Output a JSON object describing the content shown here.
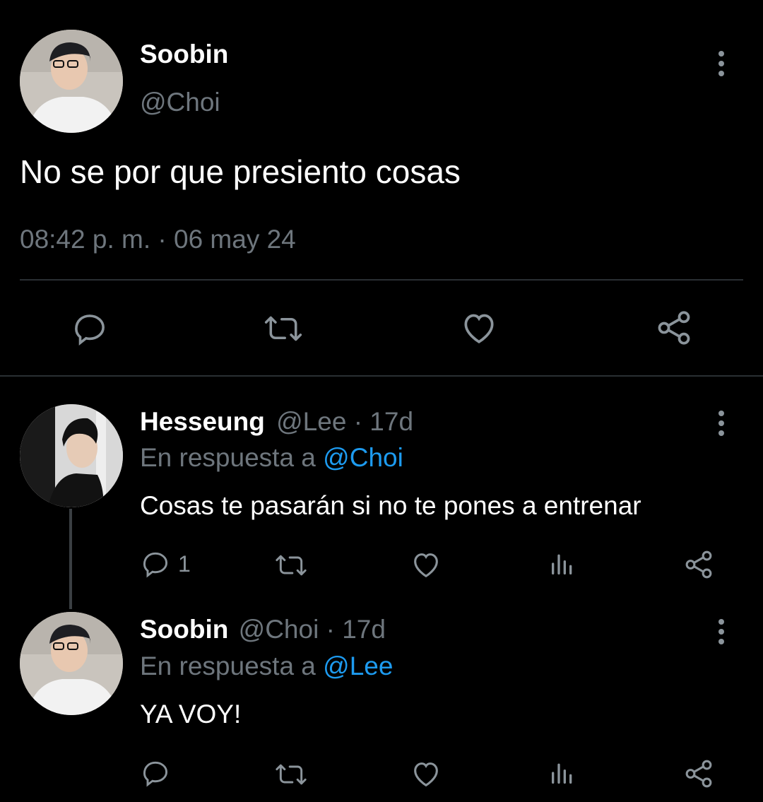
{
  "main_tweet": {
    "name": "Soobin",
    "handle": "@Choi",
    "text": "No se por que presiento cosas",
    "timestamp": "08:42 p. m. · 06 may 24"
  },
  "replies": [
    {
      "name": "Hesseung",
      "handle": "@Lee",
      "age": "· 17d",
      "reply_prefix": "En respuesta a",
      "reply_to": "@Choi",
      "text": "Cosas te pasarán si no te pones a entrenar",
      "reply_count": "1"
    },
    {
      "name": "Soobin",
      "handle": "@Choi",
      "age": "· 17d",
      "reply_prefix": "En respuesta a",
      "reply_to": "@Lee",
      "text": "YA VOY!",
      "reply_count": ""
    }
  ],
  "colors": {
    "background": "#000000",
    "text": "#e7e9ea",
    "muted": "#6e767d",
    "link": "#1d9bf0",
    "icon": "#8b949b"
  },
  "icons": [
    "more-vertical-icon",
    "reply-icon",
    "retweet-icon",
    "like-icon",
    "share-icon",
    "views-icon"
  ]
}
